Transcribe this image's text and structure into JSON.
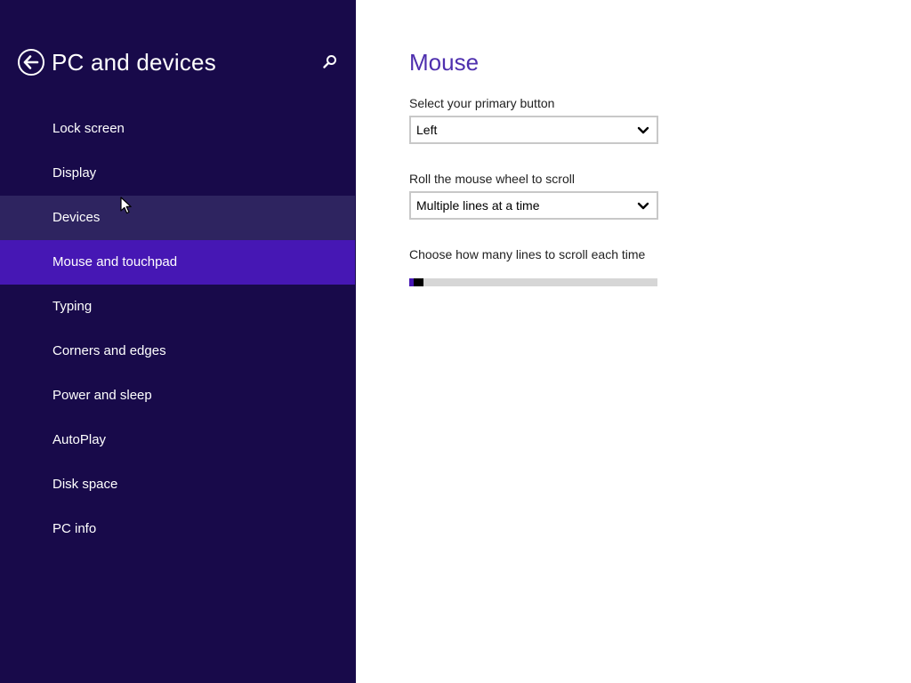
{
  "nav": {
    "title": "PC and devices",
    "back_icon": "back-arrow-circle-icon",
    "search_icon": "search-icon",
    "items": [
      {
        "label": "Lock screen",
        "state": "normal"
      },
      {
        "label": "Display",
        "state": "normal"
      },
      {
        "label": "Devices",
        "state": "hover"
      },
      {
        "label": "Mouse and touchpad",
        "state": "selected"
      },
      {
        "label": "Typing",
        "state": "normal"
      },
      {
        "label": "Corners and edges",
        "state": "normal"
      },
      {
        "label": "Power and sleep",
        "state": "normal"
      },
      {
        "label": "AutoPlay",
        "state": "normal"
      },
      {
        "label": "Disk space",
        "state": "normal"
      },
      {
        "label": "PC info",
        "state": "normal"
      }
    ]
  },
  "content": {
    "title": "Mouse",
    "primary_button": {
      "label": "Select your primary button",
      "value": "Left"
    },
    "wheel_scroll": {
      "label": "Roll the mouse wheel to scroll",
      "value": "Multiple lines at a time"
    },
    "lines_to_scroll": {
      "label": "Choose how many lines to scroll each time",
      "level_fraction": 0.02
    }
  },
  "colors": {
    "nav_background": "#180a4a",
    "nav_selected": "#4617b4",
    "nav_hover": "#2e2460",
    "accent_title": "#4e2fae"
  }
}
